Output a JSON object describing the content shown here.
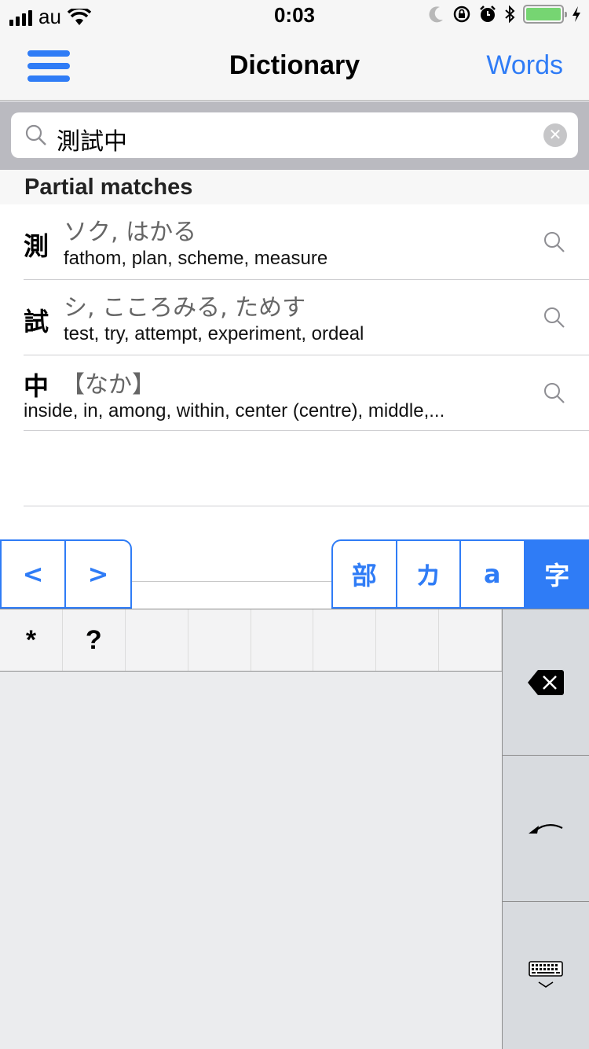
{
  "status_bar": {
    "carrier": "au",
    "time": "0:03",
    "battery_percent": 100,
    "icons": [
      "signal-icon",
      "wifi-icon",
      "moon-icon",
      "rotation-lock-icon",
      "alarm-icon",
      "bluetooth-icon",
      "battery-icon",
      "charging-icon"
    ]
  },
  "nav": {
    "title": "Dictionary",
    "right_button": "Words",
    "left_icon": "hamburger-menu-icon"
  },
  "search": {
    "value": "測試中",
    "placeholder": ""
  },
  "section": {
    "title": "Partial matches"
  },
  "results": [
    {
      "kanji": "測",
      "reading": "ソク, はかる",
      "meaning": "fathom, plan, scheme, measure"
    },
    {
      "kanji": "試",
      "reading": "シ, こころみる, ためす",
      "meaning": "test, try, attempt, experiment, ordeal"
    },
    {
      "kanji": "中",
      "reading": "【なか】",
      "meaning": "inside, in, among, within, center (centre), middle,..."
    }
  ],
  "tabs": {
    "nav_left": [
      {
        "label": "<"
      },
      {
        "label": ">"
      }
    ],
    "modes": [
      {
        "label": "部",
        "active": false
      },
      {
        "label": "カ",
        "active": false
      },
      {
        "label": "a",
        "active": false
      },
      {
        "label": "字",
        "active": true
      }
    ]
  },
  "keyboard": {
    "keys": [
      "*",
      "?",
      "",
      "",
      "",
      "",
      "",
      ""
    ],
    "side_keys": [
      "delete-icon",
      "undo-icon",
      "hide-keyboard-icon"
    ]
  },
  "colors": {
    "accent": "#2f7cf6",
    "battery": "#76d572"
  }
}
